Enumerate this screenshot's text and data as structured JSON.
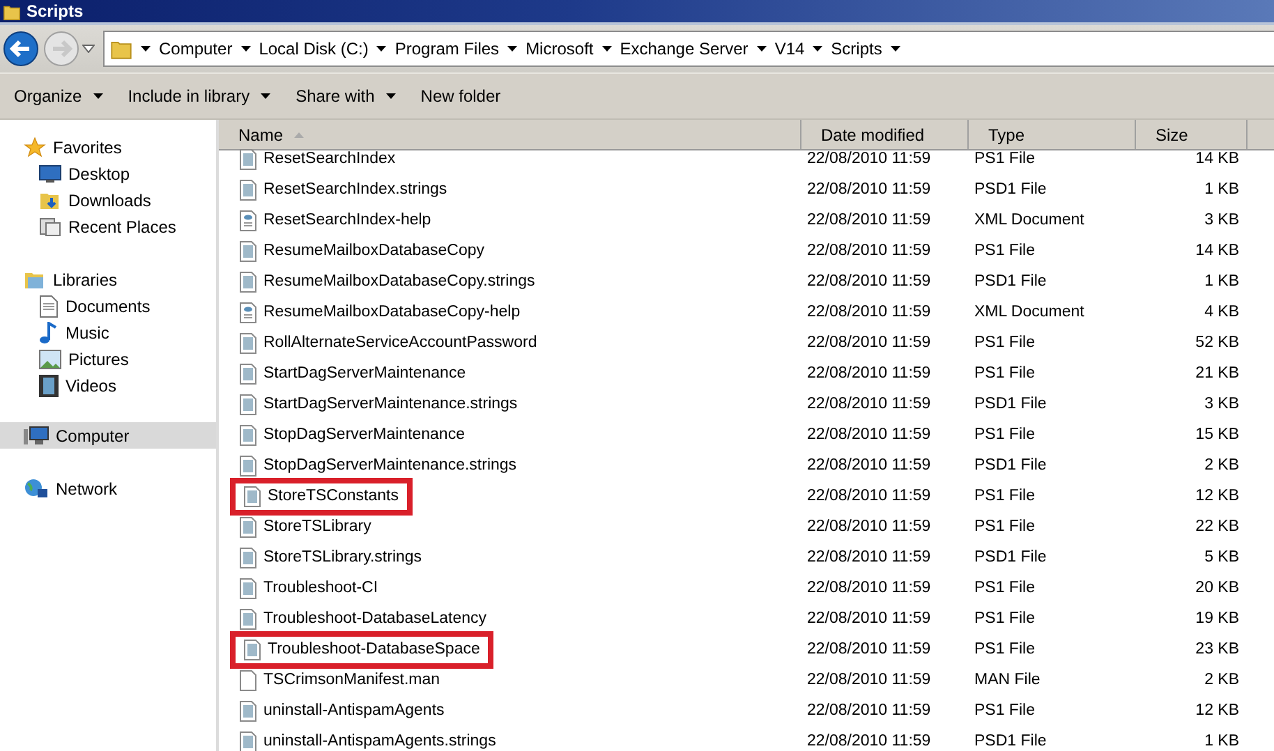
{
  "window": {
    "title": "Scripts"
  },
  "address_bar": {
    "crumbs": [
      "Computer",
      "Local Disk (C:)",
      "Program Files",
      "Microsoft",
      "Exchange Server",
      "V14",
      "Scripts"
    ]
  },
  "toolbar": [
    {
      "label": "Organize",
      "has_menu": true
    },
    {
      "label": "Include in library",
      "has_menu": true
    },
    {
      "label": "Share with",
      "has_menu": true
    },
    {
      "label": "New folder",
      "has_menu": false
    }
  ],
  "sidebar": {
    "groups": [
      {
        "label": "Favorites",
        "kind": "favorites",
        "selected": false,
        "children": [
          {
            "label": "Desktop",
            "kind": "desktop",
            "selected": false
          },
          {
            "label": "Downloads",
            "kind": "downloads",
            "selected": false
          },
          {
            "label": "Recent Places",
            "kind": "recent",
            "selected": false
          }
        ]
      },
      {
        "label": "Libraries",
        "kind": "libraries",
        "selected": false,
        "children": [
          {
            "label": "Documents",
            "kind": "documents",
            "selected": false
          },
          {
            "label": "Music",
            "kind": "music",
            "selected": false
          },
          {
            "label": "Pictures",
            "kind": "pictures",
            "selected": false
          },
          {
            "label": "Videos",
            "kind": "videos",
            "selected": false
          }
        ]
      },
      {
        "label": "Computer",
        "kind": "computer",
        "selected": true
      },
      {
        "label": "Network",
        "kind": "network",
        "selected": false
      }
    ]
  },
  "table": {
    "columns": [
      {
        "label": "Name",
        "sorted": true
      },
      {
        "label": "Date modified",
        "sorted": false
      },
      {
        "label": "Type",
        "sorted": false
      },
      {
        "label": "Size",
        "sorted": false
      }
    ],
    "rows": [
      {
        "name": "ResetSearchIndex",
        "date": "22/08/2010 11:59",
        "type": "PS1 File",
        "size": "14 KB",
        "kind": "script",
        "highlighted": false
      },
      {
        "name": "ResetSearchIndex.strings",
        "date": "22/08/2010 11:59",
        "type": "PSD1 File",
        "size": "1 KB",
        "kind": "script",
        "highlighted": false
      },
      {
        "name": "ResetSearchIndex-help",
        "date": "22/08/2010 11:59",
        "type": "XML Document",
        "size": "3 KB",
        "kind": "xml",
        "highlighted": false
      },
      {
        "name": "ResumeMailboxDatabaseCopy",
        "date": "22/08/2010 11:59",
        "type": "PS1 File",
        "size": "14 KB",
        "kind": "script",
        "highlighted": false
      },
      {
        "name": "ResumeMailboxDatabaseCopy.strings",
        "date": "22/08/2010 11:59",
        "type": "PSD1 File",
        "size": "1 KB",
        "kind": "script",
        "highlighted": false
      },
      {
        "name": "ResumeMailboxDatabaseCopy-help",
        "date": "22/08/2010 11:59",
        "type": "XML Document",
        "size": "4 KB",
        "kind": "xml",
        "highlighted": false
      },
      {
        "name": "RollAlternateServiceAccountPassword",
        "date": "22/08/2010 11:59",
        "type": "PS1 File",
        "size": "52 KB",
        "kind": "script",
        "highlighted": false
      },
      {
        "name": "StartDagServerMaintenance",
        "date": "22/08/2010 11:59",
        "type": "PS1 File",
        "size": "21 KB",
        "kind": "script",
        "highlighted": false
      },
      {
        "name": "StartDagServerMaintenance.strings",
        "date": "22/08/2010 11:59",
        "type": "PSD1 File",
        "size": "3 KB",
        "kind": "script",
        "highlighted": false
      },
      {
        "name": "StopDagServerMaintenance",
        "date": "22/08/2010 11:59",
        "type": "PS1 File",
        "size": "15 KB",
        "kind": "script",
        "highlighted": false
      },
      {
        "name": "StopDagServerMaintenance.strings",
        "date": "22/08/2010 11:59",
        "type": "PSD1 File",
        "size": "2 KB",
        "kind": "script",
        "highlighted": false
      },
      {
        "name": "StoreTSConstants",
        "date": "22/08/2010 11:59",
        "type": "PS1 File",
        "size": "12 KB",
        "kind": "script",
        "highlighted": true
      },
      {
        "name": "StoreTSLibrary",
        "date": "22/08/2010 11:59",
        "type": "PS1 File",
        "size": "22 KB",
        "kind": "script",
        "highlighted": false
      },
      {
        "name": "StoreTSLibrary.strings",
        "date": "22/08/2010 11:59",
        "type": "PSD1 File",
        "size": "5 KB",
        "kind": "script",
        "highlighted": false
      },
      {
        "name": "Troubleshoot-CI",
        "date": "22/08/2010 11:59",
        "type": "PS1 File",
        "size": "20 KB",
        "kind": "script",
        "highlighted": false
      },
      {
        "name": "Troubleshoot-DatabaseLatency",
        "date": "22/08/2010 11:59",
        "type": "PS1 File",
        "size": "19 KB",
        "kind": "script",
        "highlighted": false
      },
      {
        "name": "Troubleshoot-DatabaseSpace",
        "date": "22/08/2010 11:59",
        "type": "PS1 File",
        "size": "23 KB",
        "kind": "script",
        "highlighted": true
      },
      {
        "name": "TSCrimsonManifest.man",
        "date": "22/08/2010 11:59",
        "type": "MAN File",
        "size": "2 KB",
        "kind": "plain",
        "highlighted": false
      },
      {
        "name": "uninstall-AntispamAgents",
        "date": "22/08/2010 11:59",
        "type": "PS1 File",
        "size": "12 KB",
        "kind": "script",
        "highlighted": false
      },
      {
        "name": "uninstall-AntispamAgents.strings",
        "date": "22/08/2010 11:59",
        "type": "PSD1 File",
        "size": "1 KB",
        "kind": "script",
        "highlighted": false
      }
    ]
  }
}
